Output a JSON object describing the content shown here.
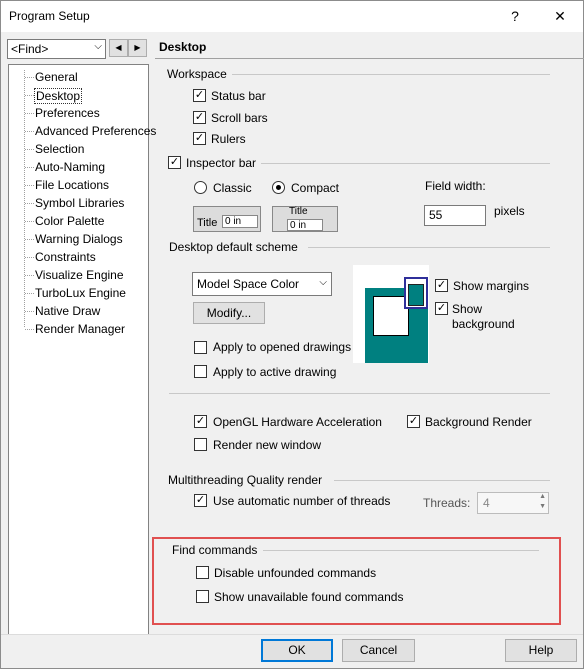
{
  "window": {
    "title": "Program Setup",
    "help_glyph": "?",
    "close_glyph": "✕"
  },
  "find": {
    "value": "<Find>",
    "arrow": "⌵",
    "prev": "◀",
    "next": "▶"
  },
  "tree": {
    "items": [
      "General",
      "Desktop",
      "Preferences",
      "Advanced Preferences",
      "Selection",
      "Auto-Naming",
      "File Locations",
      "Symbol Libraries",
      "Color Palette",
      "Warning Dialogs",
      "Constraints",
      "Visualize Engine",
      "TurboLux Engine",
      "Native Draw",
      "Render Manager"
    ],
    "selected": "Desktop"
  },
  "section": {
    "title": "Desktop"
  },
  "workspace": {
    "label": "Workspace",
    "status_bar": "Status bar",
    "scroll_bars": "Scroll bars",
    "rulers": "Rulers",
    "check": "✓"
  },
  "inspector": {
    "label": "Inspector bar",
    "classic": "Classic",
    "compact": "Compact",
    "field_width_label": "Field width:",
    "field_width_value": "55",
    "pixels": "pixels",
    "preview_title": "Title",
    "preview_value": "0 in"
  },
  "scheme": {
    "label": "Desktop default scheme",
    "selected": "Model Space Color",
    "modify": "Modify...",
    "show_margins": "Show margins",
    "show_background": "Show background",
    "apply_opened": "Apply to opened drawings",
    "apply_active": "Apply to active drawing",
    "colors": {
      "teal": "#008080"
    }
  },
  "render": {
    "opengl": "OpenGL Hardware Acceleration",
    "background_render": "Background Render",
    "new_window": "Render new window"
  },
  "multithreading": {
    "label": "Multithreading Quality render",
    "auto_threads": "Use automatic number of threads",
    "threads_label": "Threads:",
    "threads_value": "4"
  },
  "find_commands": {
    "label": "Find commands",
    "disable_unfounded": "Disable unfounded commands",
    "show_unavailable": "Show unavailable found commands"
  },
  "footer": {
    "ok": "OK",
    "cancel": "Cancel",
    "help": "Help"
  }
}
